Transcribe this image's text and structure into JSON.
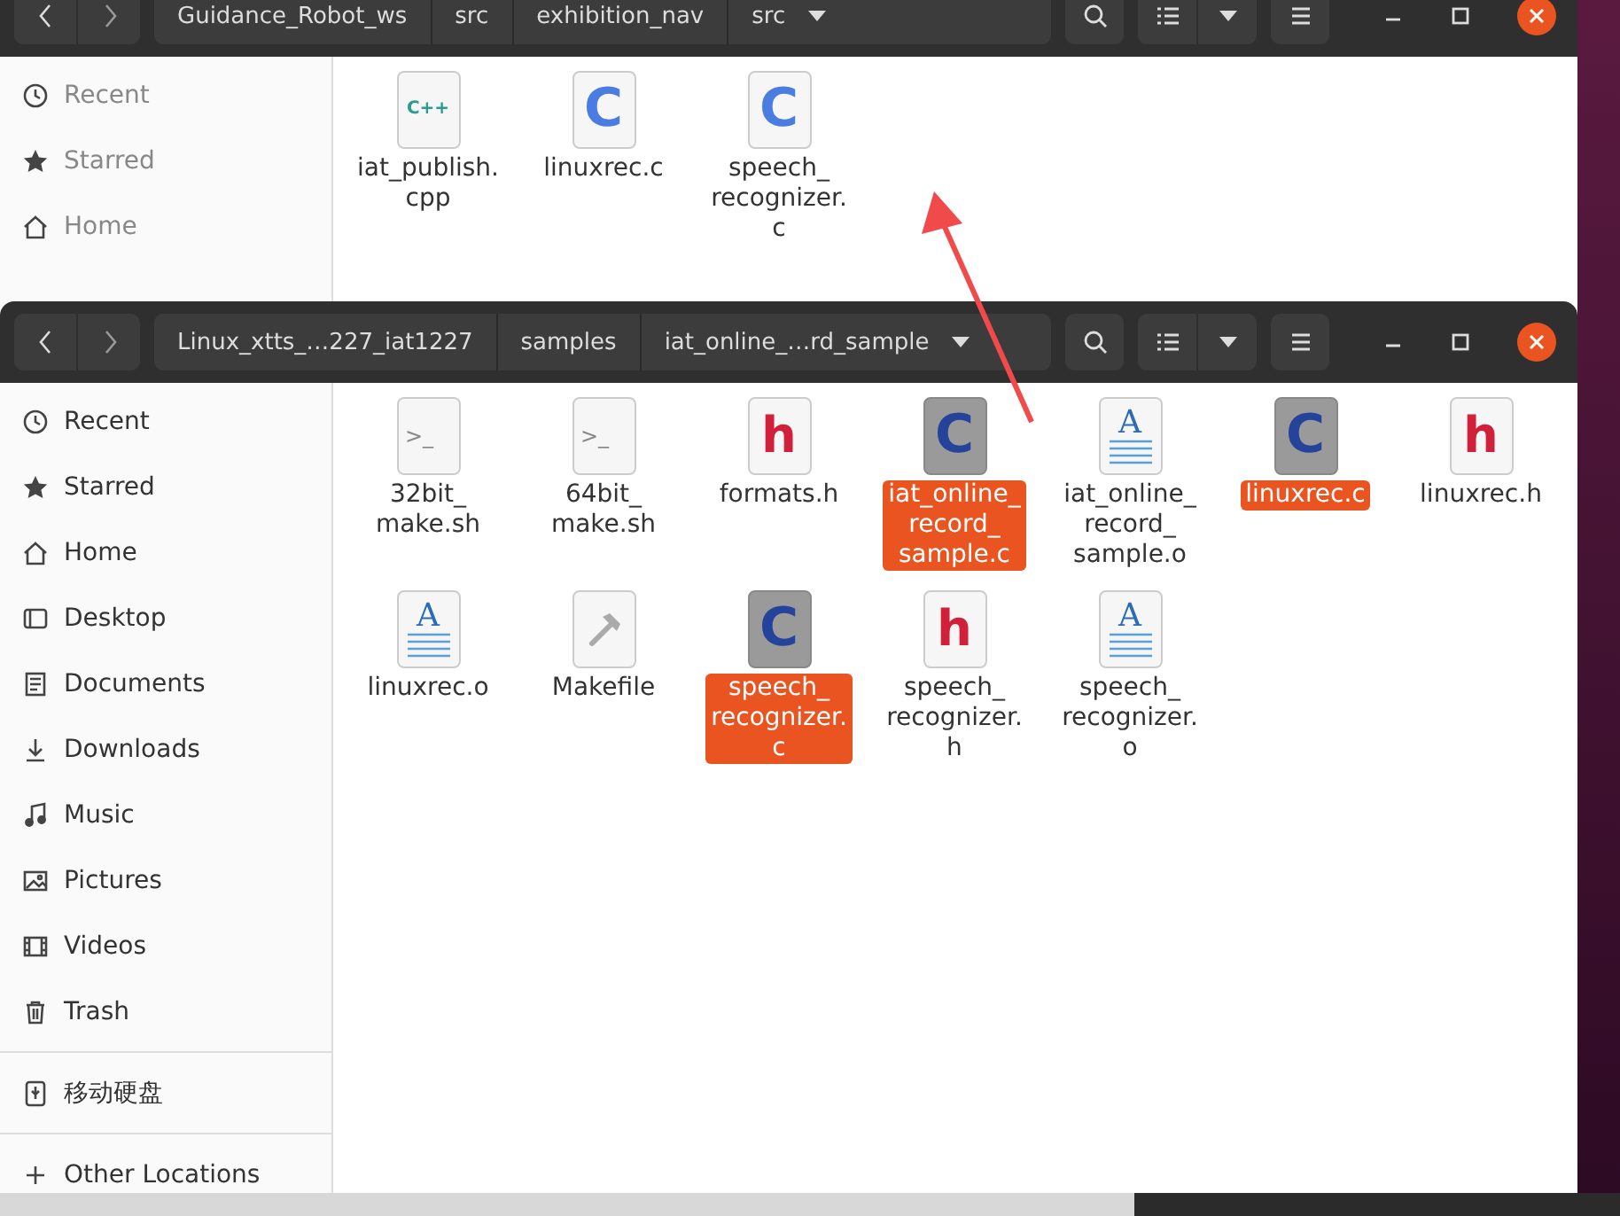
{
  "back_window": {
    "path": [
      {
        "label": "Guidance_Robot_ws",
        "dropdown": false
      },
      {
        "label": "src",
        "dropdown": false
      },
      {
        "label": "exhibition_nav",
        "dropdown": false
      },
      {
        "label": "src",
        "dropdown": true
      }
    ],
    "sidebar": [
      {
        "label": "Recent",
        "kind": "recent"
      },
      {
        "label": "Starred",
        "kind": "starred"
      },
      {
        "label": "Home",
        "kind": "home"
      }
    ],
    "files": [
      {
        "name": "iat_publish.\ncpp",
        "kind": "cpp",
        "glyph": "C++",
        "selected": false
      },
      {
        "name": "linuxrec.c",
        "kind": "c",
        "glyph": "C",
        "selected": false
      },
      {
        "name": "speech_\nrecognizer.\nc",
        "kind": "c",
        "glyph": "C",
        "selected": false
      }
    ]
  },
  "front_window": {
    "path": [
      {
        "label": "Linux_xtts_…227_iat1227",
        "dropdown": false
      },
      {
        "label": "samples",
        "dropdown": false
      },
      {
        "label": "iat_online_…rd_sample",
        "dropdown": true
      }
    ],
    "sidebar": [
      {
        "label": "Recent",
        "kind": "recent"
      },
      {
        "label": "Starred",
        "kind": "starred"
      },
      {
        "label": "Home",
        "kind": "home"
      },
      {
        "label": "Desktop",
        "kind": "desktop"
      },
      {
        "label": "Documents",
        "kind": "documents"
      },
      {
        "label": "Downloads",
        "kind": "downloads"
      },
      {
        "label": "Music",
        "kind": "music"
      },
      {
        "label": "Pictures",
        "kind": "pictures"
      },
      {
        "label": "Videos",
        "kind": "videos"
      },
      {
        "label": "Trash",
        "kind": "trash"
      },
      {
        "label": "移动硬盘",
        "kind": "usb",
        "divider_before": true
      },
      {
        "label": "Other Locations",
        "kind": "plus",
        "divider_before": true
      }
    ],
    "files": [
      {
        "name": "32bit_\nmake.sh",
        "kind": "sh",
        "glyph": ">_",
        "selected": false
      },
      {
        "name": "64bit_\nmake.sh",
        "kind": "sh",
        "glyph": ">_",
        "selected": false
      },
      {
        "name": "formats.h",
        "kind": "h",
        "glyph": "h",
        "selected": false
      },
      {
        "name": "iat_online_\nrecord_\nsample.c",
        "kind": "c",
        "glyph": "C",
        "selected": true
      },
      {
        "name": "iat_online_\nrecord_\nsample.o",
        "kind": "o",
        "glyph": "A",
        "selected": false
      },
      {
        "name": "linuxrec.c",
        "kind": "c",
        "glyph": "C",
        "selected": true
      },
      {
        "name": "linuxrec.h",
        "kind": "h",
        "glyph": "h",
        "selected": false
      },
      {
        "name": "linuxrec.o",
        "kind": "o",
        "glyph": "A",
        "selected": false
      },
      {
        "name": "Makefile",
        "kind": "make",
        "selected": false
      },
      {
        "name": "speech_\nrecognizer.\nc",
        "kind": "c",
        "glyph": "C",
        "selected": true
      },
      {
        "name": "speech_\nrecognizer.\nh",
        "kind": "h",
        "glyph": "h",
        "selected": false
      },
      {
        "name": "speech_\nrecognizer.\no",
        "kind": "o",
        "glyph": "A",
        "selected": false
      }
    ]
  }
}
